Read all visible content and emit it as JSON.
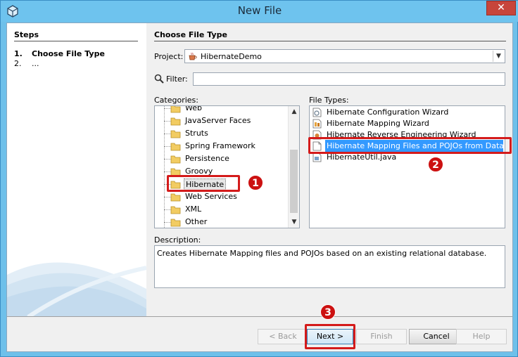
{
  "window": {
    "title": "New File"
  },
  "steps": {
    "heading": "Steps",
    "items": [
      {
        "num": "1.",
        "label": "Choose File Type"
      },
      {
        "num": "2.",
        "label": "..."
      }
    ]
  },
  "main": {
    "heading": "Choose File Type",
    "project_label": "Project:",
    "project_value": "HibernateDemo",
    "filter_label": "Filter:",
    "filter_value": "",
    "categories_label": "Categories:",
    "categories": [
      "Web",
      "JavaServer Faces",
      "Struts",
      "Spring Framework",
      "Persistence",
      "Groovy",
      "Hibernate",
      "Web Services",
      "XML",
      "Other"
    ],
    "selected_category": "Hibernate",
    "file_types_label": "File Types:",
    "file_types": [
      {
        "label": "Hibernate Configuration Wizard",
        "icon": "hibernate-config-icon"
      },
      {
        "label": "Hibernate Mapping Wizard",
        "icon": "hibernate-mapping-icon"
      },
      {
        "label": "Hibernate Reverse Engineering Wizard",
        "icon": "hibernate-reveng-icon"
      },
      {
        "label": "Hibernate Mapping Files and POJOs from Database",
        "icon": "document-icon"
      },
      {
        "label": "HibernateUtil.java",
        "icon": "java-file-icon"
      }
    ],
    "selected_file_type": "Hibernate Mapping Files and POJOs from Database",
    "description_label": "Description:",
    "description": "Creates Hibernate Mapping files and POJOs based on an existing relational database."
  },
  "buttons": {
    "back": "< Back",
    "next": "Next >",
    "finish": "Finish",
    "cancel": "Cancel",
    "help": "Help"
  },
  "annotations": {
    "badge1": "1",
    "badge2": "2",
    "badge3": "3",
    "color": "#d41b1b"
  },
  "colors": {
    "selection": "#3399ff",
    "titlebar": "#6ec3ee"
  }
}
